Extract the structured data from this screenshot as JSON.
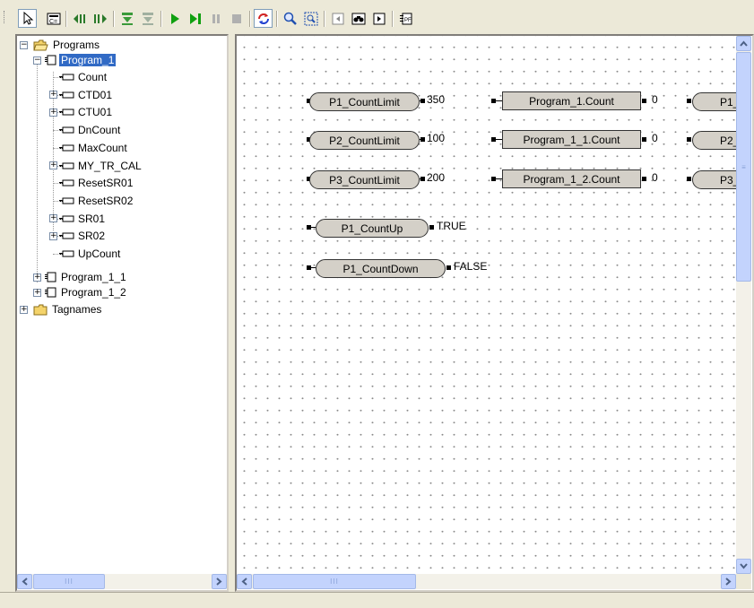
{
  "colors": {
    "selection": "#316ac5",
    "window_bg": "#ece9d8",
    "canvas_dot": "#8a8a8a",
    "play_green": "#10a010"
  },
  "toolbar": {
    "buttons": [
      {
        "icon": "pointer-icon"
      },
      {
        "icon": "instruction-icon"
      },
      {
        "icon": "step-left-icon"
      },
      {
        "icon": "step-right-icon"
      },
      {
        "icon": "download-icon"
      },
      {
        "icon": "upload-icon"
      },
      {
        "icon": "run-icon"
      },
      {
        "icon": "step-run-icon"
      },
      {
        "icon": "pause-icon"
      },
      {
        "icon": "stop-icon"
      },
      {
        "icon": "refresh-icon"
      },
      {
        "icon": "zoom-icon"
      },
      {
        "icon": "zoom-fit-icon"
      },
      {
        "icon": "prev-icon"
      },
      {
        "icon": "binoculars-icon"
      },
      {
        "icon": "next-icon"
      },
      {
        "icon": "program-icon"
      }
    ]
  },
  "tree": {
    "root": "Programs",
    "program1": "Program_1",
    "children": [
      "Count",
      "CTD01",
      "CTU01",
      "DnCount",
      "MaxCount",
      "MY_TR_CAL",
      "ResetSR01",
      "ResetSR02",
      "SR01",
      "SR02",
      "UpCount"
    ],
    "program2": "Program_1_1",
    "program3": "Program_1_2",
    "tagnames": "Tagnames"
  },
  "canvas": {
    "row1": {
      "pill": "P1_CountLimit",
      "value": "350",
      "box": "Program_1.Count",
      "box_value": "0",
      "right": "P1_"
    },
    "row2": {
      "pill": "P2_CountLimit",
      "value": "100",
      "box": "Program_1_1.Count",
      "box_value": "0",
      "right": "P2_"
    },
    "row3": {
      "pill": "P3_CountLimit",
      "value": "200",
      "box": "Program_1_2.Count",
      "box_value": "0",
      "right": "P3_"
    },
    "up": {
      "pill": "P1_CountUp",
      "value": "TRUE"
    },
    "down": {
      "pill": "P1_CountDown",
      "value": "FALSE"
    }
  }
}
